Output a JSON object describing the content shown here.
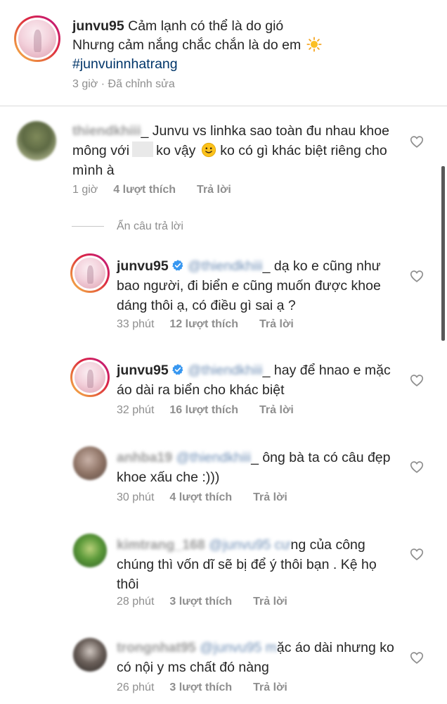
{
  "post": {
    "username": "junvu95",
    "caption_line1": "Cảm lạnh có thể là do gió",
    "caption_line2": "Nhưng cảm nắng chắc chắn là do em",
    "emoji_icon": "sun-emoji",
    "hashtag": "#junvuinnhatrang",
    "time": "3 giờ",
    "separator": "·",
    "edited": "Đã chỉnh sửa"
  },
  "hide_replies_label": "Ẩn câu trả lời",
  "comments": [
    {
      "username_blurred": "thiendkhiii",
      "text_part1": "_ Junvu vs linhka sao toàn đu nhau khoe mông với",
      "text_part2": "ko vậy",
      "emoji_icon": "slightly-smiling-emoji",
      "text_part3": "ko có gì khác biệt riêng cho mình à",
      "time": "1 giờ",
      "likes": "4 lượt thích",
      "reply": "Trả lời"
    },
    {
      "username": "junvu95",
      "mention_blurred": "@thiendkhiii",
      "text": "_ dạ ko e cũng như bao người, đi biển e cũng muốn được khoe dáng thôi ạ, có điều gì sai ạ ?",
      "time": "33 phút",
      "likes": "12 lượt thích",
      "reply": "Trả lời"
    },
    {
      "username": "junvu95",
      "mention_blurred": "@thiendkhiii",
      "text": "_ hay để hnao e mặc áo dài ra biển cho khác biệt",
      "time": "32 phút",
      "likes": "16 lượt thích",
      "reply": "Trả lời"
    },
    {
      "username_blurred": "anhba19",
      "mention_blurred": "@thiendkhiii",
      "text": "_ ông bà ta có câu đẹp khoe xấu che :)))",
      "time": "30 phút",
      "likes": "4 lượt thích",
      "reply": "Trả lời"
    },
    {
      "username_blurred": "kimtrang_168",
      "mention_blurred": "@junvu95 cư",
      "text": "ng của công chúng thì vốn dĩ sẽ bị để ý thôi bạn . Kệ họ thôi",
      "time": "28 phút",
      "likes": "3 lượt thích",
      "reply": "Trả lời"
    },
    {
      "username_blurred": "trongnhat95",
      "mention_blurred": "@junvu95 m",
      "text": "ặc áo dài nhưng ko có nội y ms chất đó nàng",
      "time": "26 phút",
      "likes": "3 lượt thích",
      "reply": "Trả lời"
    }
  ],
  "colors": {
    "text": "#262626",
    "muted": "#8e8e8e",
    "divider": "#dbdbdb",
    "verified": "#3897f0"
  }
}
